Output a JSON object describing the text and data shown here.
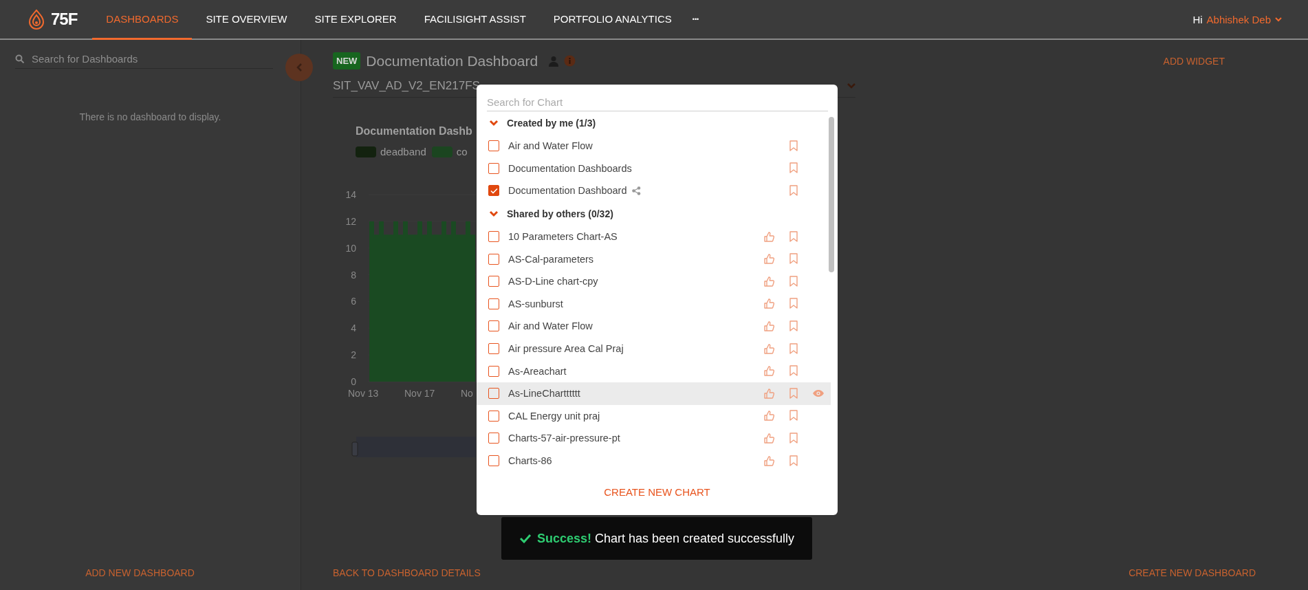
{
  "nav": {
    "logo": "75F",
    "tabs": [
      {
        "label": "DASHBOARDS",
        "selected": true
      },
      {
        "label": "SITE OVERVIEW",
        "selected": false
      },
      {
        "label": "SITE EXPLORER",
        "selected": false
      },
      {
        "label": "FACILISIGHT ASSIST",
        "selected": false
      },
      {
        "label": "PORTFOLIO ANALYTICS",
        "selected": false
      }
    ],
    "more": "•••",
    "greeting": "Hi",
    "user": "Abhishek Deb"
  },
  "sidebar": {
    "search_placeholder": "Search for Dashboards",
    "empty_message": "There is no dashboard to display.",
    "add_button": "ADD NEW DASHBOARD"
  },
  "dashboard": {
    "badge": "NEW",
    "title": "Documentation Dashboard",
    "add_widget": "ADD WIDGET",
    "site_select": "SIT_VAV_AD_V2_EN217FS",
    "widget": {
      "title": "Documentation Dashb",
      "legend": [
        {
          "label": "deadband",
          "color": "#13220f"
        },
        {
          "label": "co",
          "color": "#1b4520"
        }
      ],
      "y_labels": [
        "14",
        "12",
        "10",
        "8",
        "6",
        "4",
        "2",
        "0"
      ],
      "x_labels": [
        "Nov 13",
        "Nov 17",
        "No"
      ]
    },
    "back_button": "BACK TO DASHBOARD DETAILS",
    "create_button": "CREATE NEW DASHBOARD"
  },
  "chart_picker": {
    "placeholder": "Search for Chart",
    "sections": [
      {
        "title": "Created by me (1/3)",
        "kind": "own",
        "expanded": true,
        "items": [
          {
            "label": "Air and Water Flow",
            "checked": false,
            "shared": false,
            "hovered": false
          },
          {
            "label": "Documentation Dashboards",
            "checked": false,
            "shared": false,
            "hovered": false
          },
          {
            "label": "Documentation Dashboard",
            "checked": true,
            "shared": true,
            "hovered": false
          }
        ]
      },
      {
        "title": "Shared by others (0/32)",
        "kind": "shared",
        "expanded": true,
        "items": [
          {
            "label": "10 Parameters Chart-AS",
            "checked": false,
            "shared": false,
            "hovered": false
          },
          {
            "label": "AS-Cal-parameters",
            "checked": false,
            "shared": false,
            "hovered": false
          },
          {
            "label": "AS-D-Line chart-cpy",
            "checked": false,
            "shared": false,
            "hovered": false
          },
          {
            "label": "AS-sunburst",
            "checked": false,
            "shared": false,
            "hovered": false
          },
          {
            "label": "Air and Water Flow",
            "checked": false,
            "shared": false,
            "hovered": false
          },
          {
            "label": "Air pressure Area Cal Praj",
            "checked": false,
            "shared": false,
            "hovered": false
          },
          {
            "label": "As-Areachart",
            "checked": false,
            "shared": false,
            "hovered": false
          },
          {
            "label": "As-LineChartttttt",
            "checked": false,
            "shared": false,
            "hovered": true
          },
          {
            "label": "CAL Energy unit praj",
            "checked": false,
            "shared": false,
            "hovered": false
          },
          {
            "label": "Charts-57-air-pressure-pt",
            "checked": false,
            "shared": false,
            "hovered": false
          },
          {
            "label": "Charts-86",
            "checked": false,
            "shared": false,
            "hovered": false
          }
        ]
      }
    ],
    "create_button": "CREATE NEW CHART"
  },
  "toast": {
    "title": "Success!",
    "message": "Chart has been created successfully"
  }
}
